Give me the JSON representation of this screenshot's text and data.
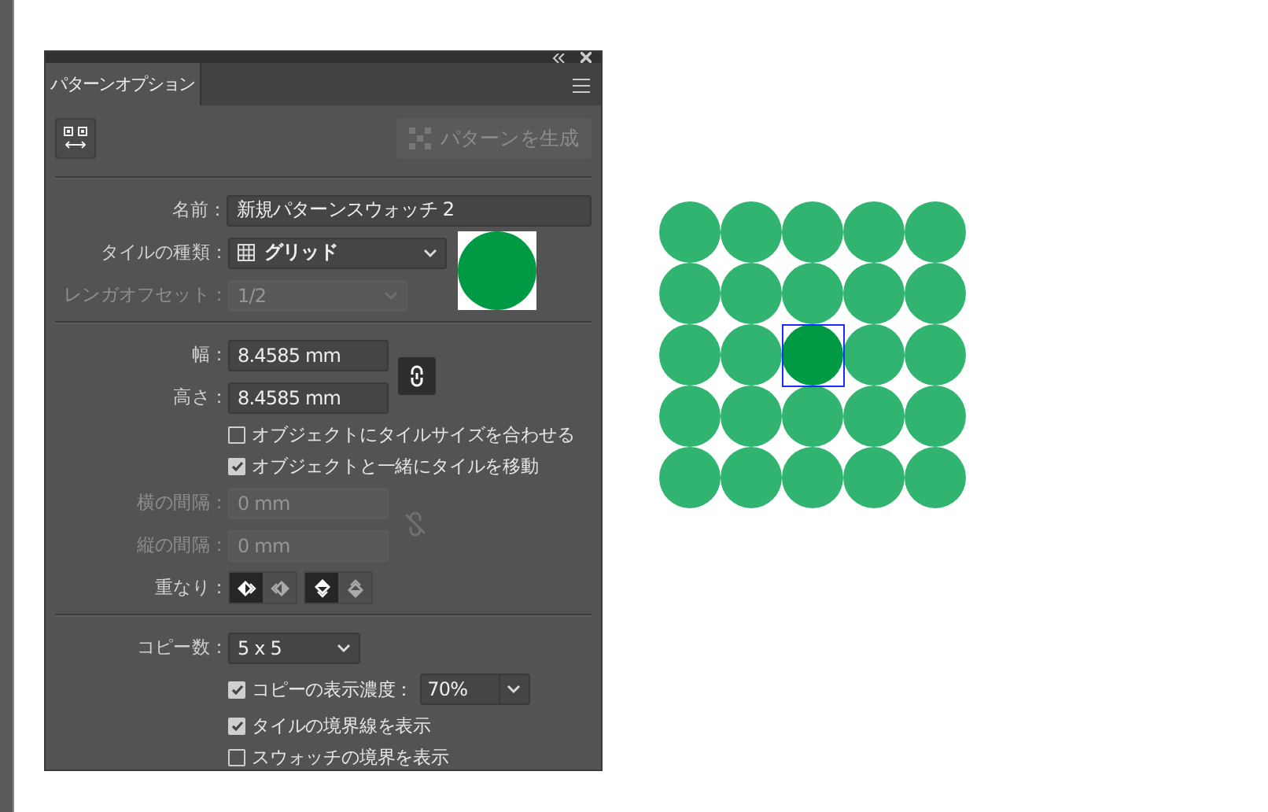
{
  "panel": {
    "tab": "パターンオプション",
    "make_pattern_button": "パターンを生成",
    "name": {
      "label": "名前：",
      "value": "新規パターンスウォッチ 2"
    },
    "tile_type": {
      "label": "タイルの種類：",
      "value": "グリッド"
    },
    "brick_offset": {
      "label": "レンガオフセット：",
      "value": "1/2",
      "disabled": true
    },
    "width": {
      "label": "幅：",
      "value": "8.4585 mm"
    },
    "height": {
      "label": "高さ：",
      "value": "8.4585 mm"
    },
    "size_linked": true,
    "size_options": [
      {
        "label": "オブジェクトにタイルサイズを合わせる",
        "checked": false
      },
      {
        "label": "オブジェクトと一緒にタイルを移動",
        "checked": true
      }
    ],
    "h_spacing": {
      "label": "横の間隔：",
      "value": "0 mm",
      "disabled": true
    },
    "v_spacing": {
      "label": "縦の間隔：",
      "value": "0 mm",
      "disabled": true
    },
    "overlap": {
      "label": "重なり：",
      "buttons": [
        {
          "kind": "left",
          "selected": true
        },
        {
          "kind": "right",
          "selected": false
        },
        {
          "kind": "top",
          "selected": true
        },
        {
          "kind": "bottom",
          "selected": false
        }
      ]
    },
    "copies": {
      "label": "コピー数：",
      "value": "5 x 5"
    },
    "dim_copies": {
      "label": "コピーの表示濃度：",
      "checked": true,
      "value": "70%"
    },
    "show_options": [
      {
        "label": "タイルの境界線を表示",
        "checked": true
      },
      {
        "label": "スウォッチの境界を表示",
        "checked": false
      }
    ]
  }
}
